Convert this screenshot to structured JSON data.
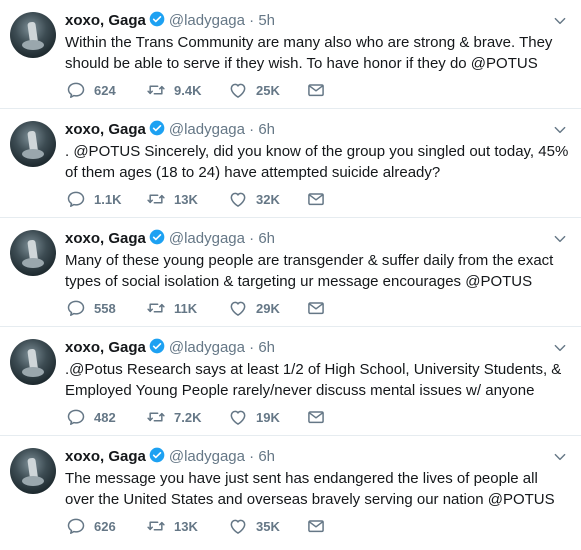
{
  "tweets": [
    {
      "name": "xoxo, Gaga",
      "handle": "@ladygaga",
      "time": "5h",
      "text": "Within the Trans Community are many also who are strong & brave.  They should be able to serve if they wish. To have honor if they do @POTUS",
      "replies": "624",
      "retweets": "9.4K",
      "likes": "25K"
    },
    {
      "name": "xoxo, Gaga",
      "handle": "@ladygaga",
      "time": "6h",
      "text": ". @POTUS Sincerely, did you know of the group you singled out today, 45% of them ages (18 to 24) have attempted suicide already?",
      "replies": "1.1K",
      "retweets": "13K",
      "likes": "32K"
    },
    {
      "name": "xoxo, Gaga",
      "handle": "@ladygaga",
      "time": "6h",
      "text": "Many of these young people are transgender & suffer daily from the exact types of social isolation & targeting ur message encourages @POTUS",
      "replies": "558",
      "retweets": "11K",
      "likes": "29K"
    },
    {
      "name": "xoxo, Gaga",
      "handle": "@ladygaga",
      "time": "6h",
      "text": ".@Potus Research says at least 1/2 of High School, University Students, & Employed Young People rarely/never discuss mental issues w/ anyone",
      "replies": "482",
      "retweets": "7.2K",
      "likes": "19K"
    },
    {
      "name": "xoxo, Gaga",
      "handle": "@ladygaga",
      "time": "6h",
      "text": "The message you have just sent has endangered the lives of people all over the United States and overseas bravely serving our nation @POTUS",
      "replies": "626",
      "retweets": "13K",
      "likes": "35K"
    }
  ],
  "separator": "·",
  "icons": {
    "reply": "reply-icon",
    "retweet": "retweet-icon",
    "like": "heart-icon",
    "dm": "envelope-icon",
    "verified": "verified-badge-icon",
    "more": "chevron-down-icon"
  },
  "colors": {
    "text": "#14171a",
    "secondary": "#657786",
    "verified": "#1da1f2",
    "divider": "#e6ecf0"
  }
}
